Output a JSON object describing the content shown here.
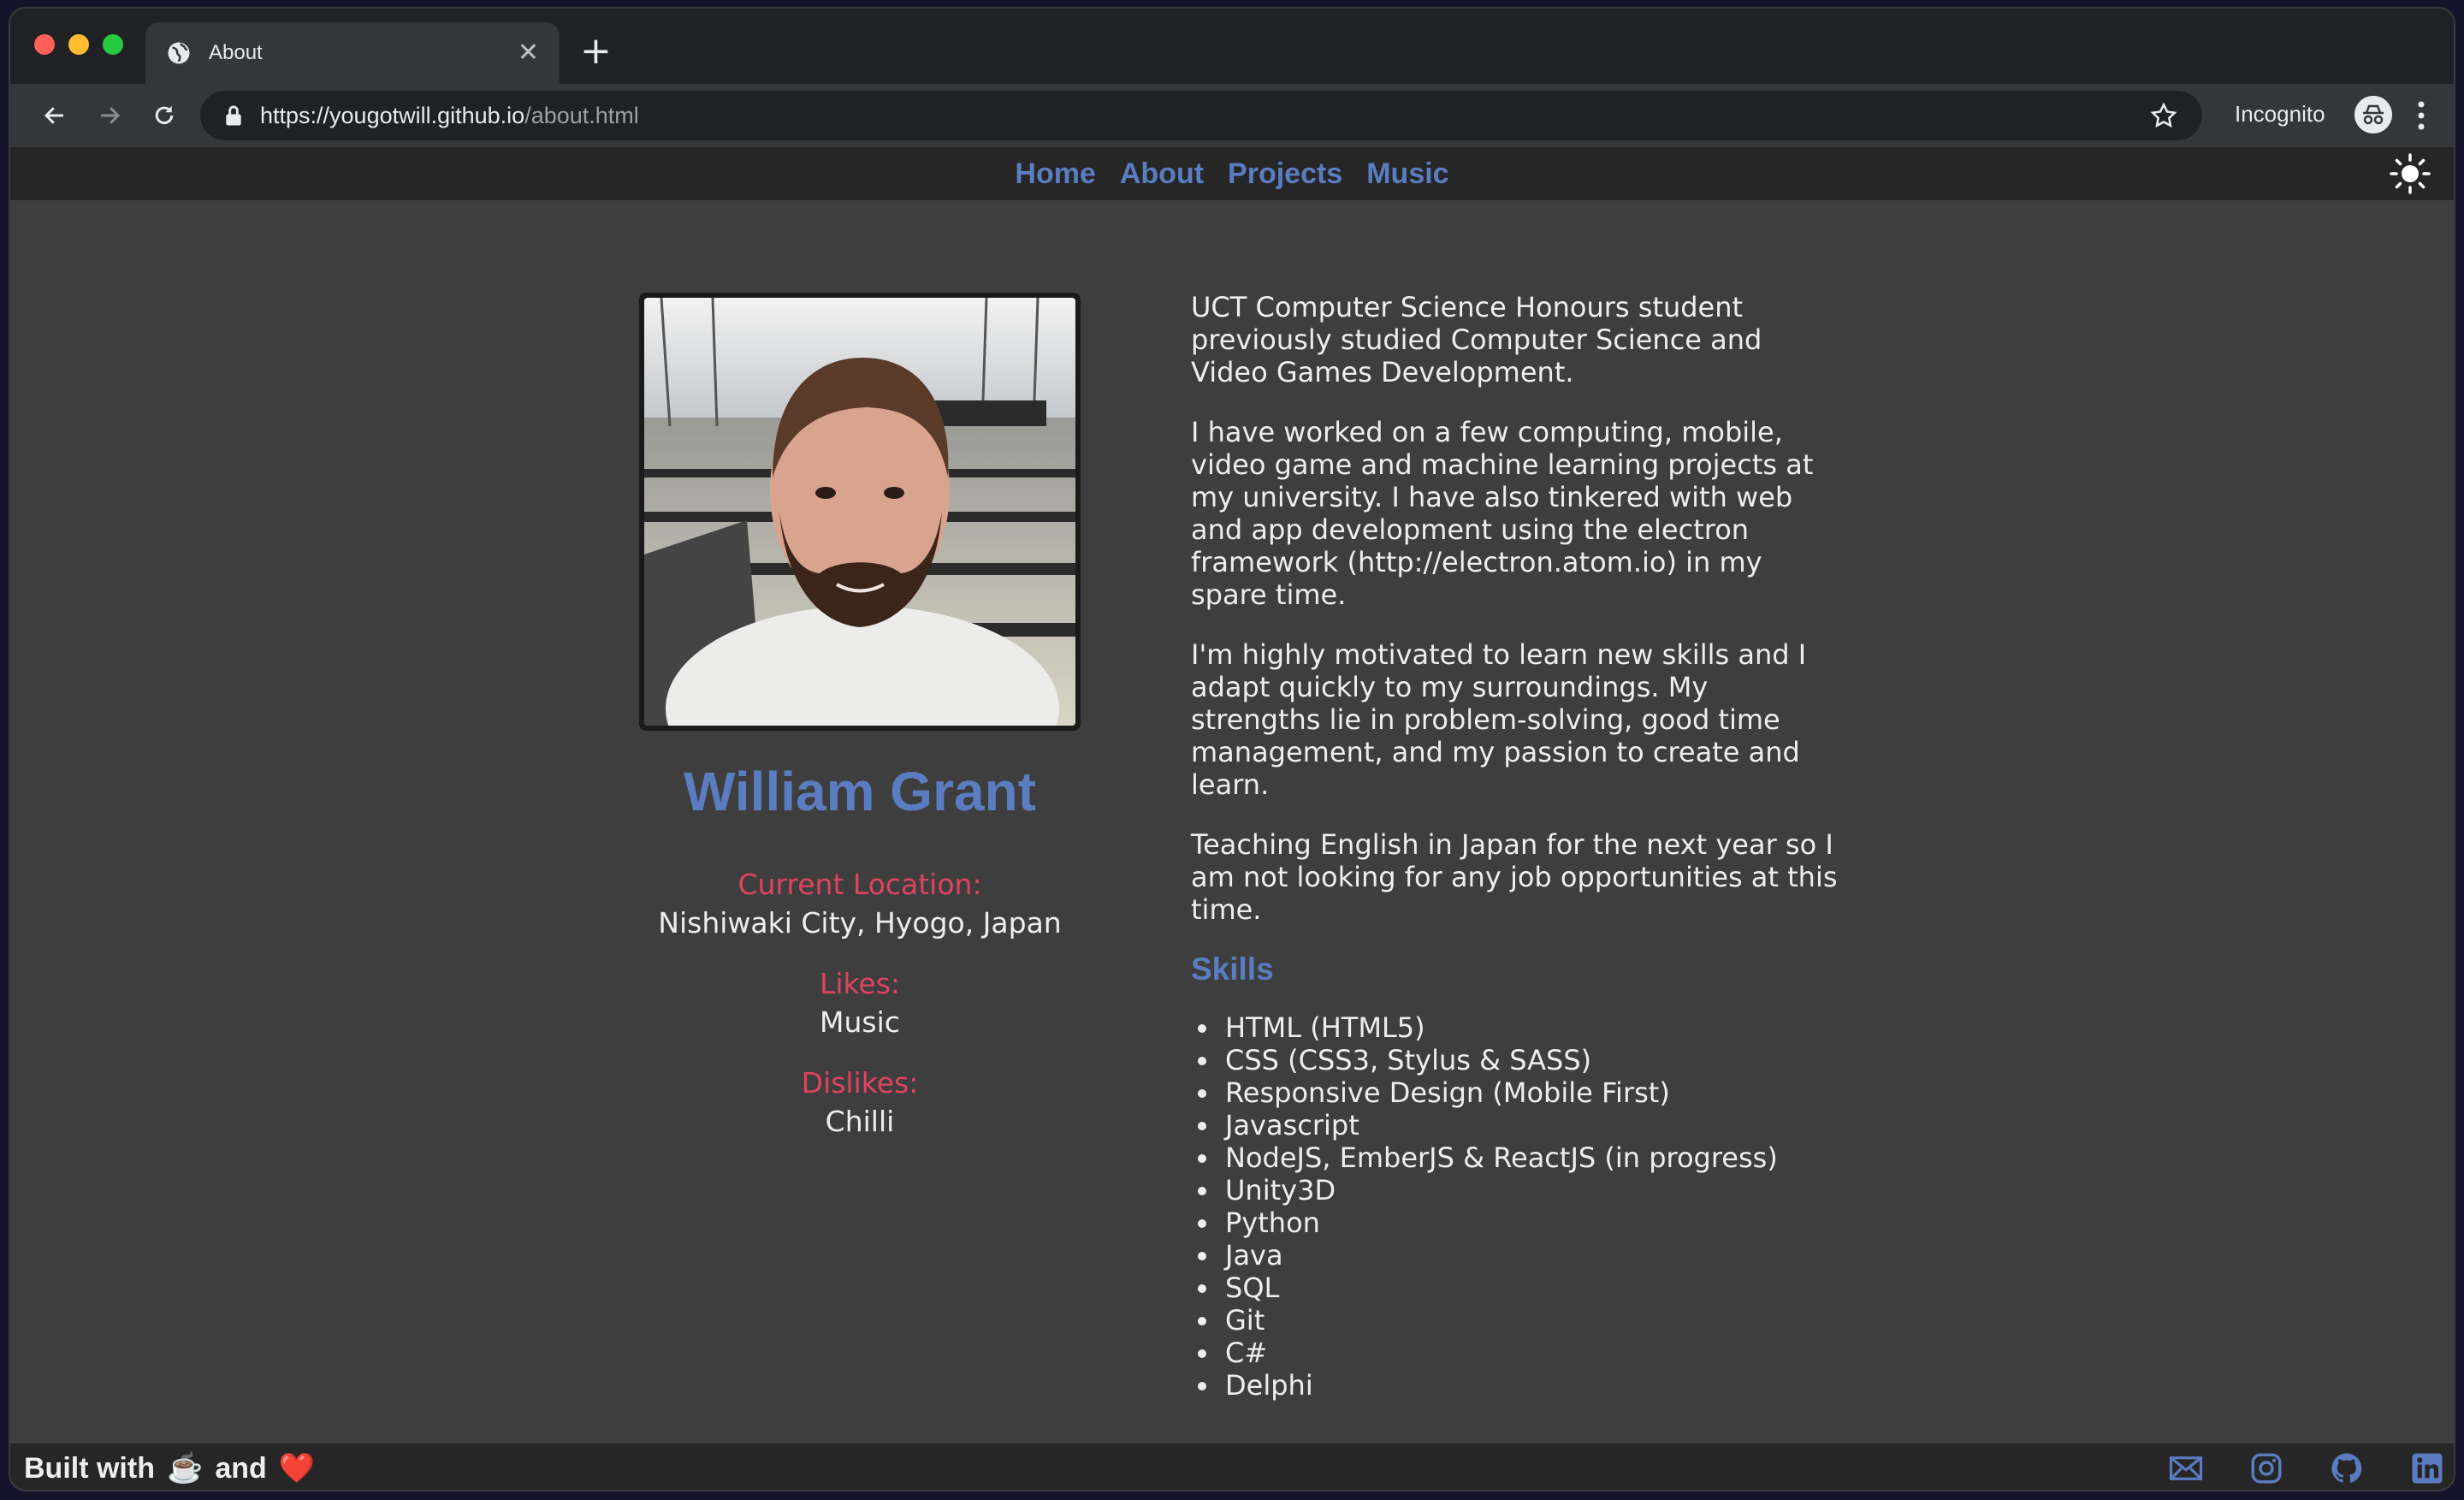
{
  "browser": {
    "tab_title": "About",
    "url_host": "https://yougotwill.github.io",
    "url_path": "/about.html",
    "incognito_label": "Incognito",
    "icons": [
      "globe-icon",
      "close-icon",
      "new-tab-icon",
      "back-icon",
      "forward-icon",
      "reload-icon",
      "lock-icon",
      "star-icon",
      "incognito-icon",
      "more-icon"
    ]
  },
  "nav": {
    "items": [
      "Home",
      "About",
      "Projects",
      "Music"
    ],
    "theme_icon": "sun-icon"
  },
  "profile": {
    "name": "William Grant",
    "location_label": "Current Location:",
    "location_value": "Nishiwaki City, Hyogo, Japan",
    "likes_label": "Likes:",
    "likes_value": "Music",
    "dislikes_label": "Dislikes:",
    "dislikes_value": "Chilli"
  },
  "bio": {
    "paragraphs": [
      "UCT Computer Science Honours student previously studied Computer Science and Video Games Development.",
      "I have worked on a few computing, mobile, video game and machine learning projects at my university. I have also tinkered with web and app development using the electron framework (http://electron.atom.io) in my spare time.",
      "I'm highly motivated to learn new skills and I adapt quickly to my surroundings. My strengths lie in problem-solving, good time management, and my passion to create and learn.",
      "Teaching English in Japan for the next year so I am not looking for any job opportunities at this time."
    ],
    "skills_title": "Skills",
    "skills": [
      "HTML (HTML5)",
      "CSS (CSS3, Stylus & SASS)",
      "Responsive Design (Mobile First)",
      "Javascript",
      "NodeJS, EmberJS & ReactJS (in progress)",
      "Unity3D",
      "Python",
      "Java",
      "SQL",
      "Git",
      "C#",
      "Delphi"
    ]
  },
  "footer": {
    "built_with": "Built with",
    "and": "and",
    "coffee": "☕",
    "heart": "❤️",
    "social_icons": [
      "mail-icon",
      "instagram-icon",
      "github-icon",
      "linkedin-icon"
    ]
  },
  "colors": {
    "accent_blue": "#5a7cc0",
    "label_red": "#e0435f",
    "page_bg": "#3e3e3e",
    "bar_bg": "#262626"
  }
}
